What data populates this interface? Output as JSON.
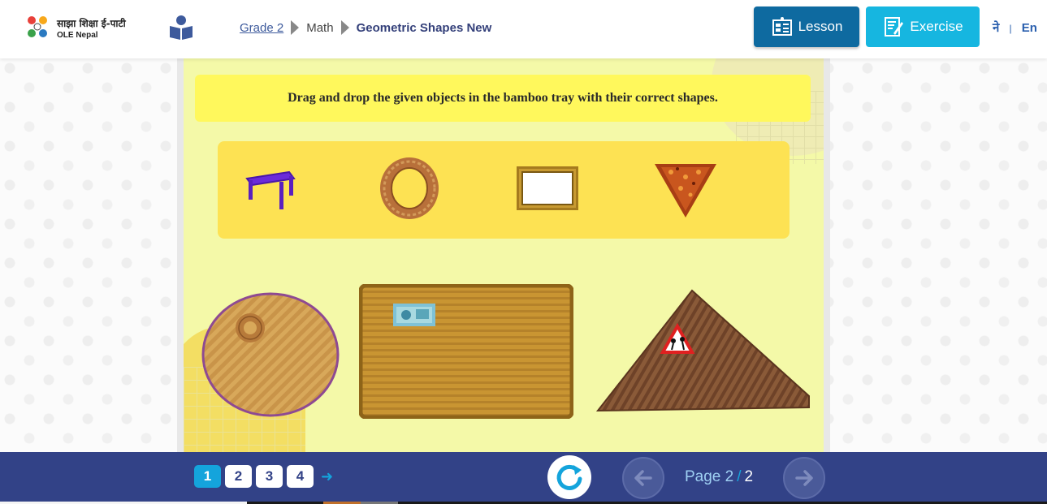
{
  "header": {
    "logo_title": "साझा शिक्षा ई-पाटी",
    "logo_subtitle": "OLE Nepal",
    "breadcrumb": {
      "grade": "Grade 2",
      "subject": "Math",
      "topic": "Geometric Shapes New"
    },
    "lesson_label": "Lesson",
    "exercise_label": "Exercise",
    "lang_ne": "ने",
    "lang_sep": "|",
    "lang_en": "En"
  },
  "activity": {
    "instruction": "Drag and drop the given objects in the bamboo tray with their correct shapes.",
    "objects": [
      "stool",
      "bread-ring",
      "picture-frame",
      "samosa"
    ],
    "trays": [
      "circle-tray",
      "rectangle-tray",
      "triangle-tray"
    ]
  },
  "footer": {
    "tabs": [
      "1",
      "2",
      "3",
      "4"
    ],
    "active_tab": "1",
    "page_label": "Page",
    "current_page": "2",
    "page_sep": "/",
    "total_pages": "2"
  },
  "colors": {
    "header_lesson": "#0e6aa0",
    "header_exercise": "#16b6e0",
    "footer_bg": "#324287",
    "panel_bg": "#f4f9a8",
    "instruction_bg": "#fff85c",
    "tray_bg": "#fde253"
  }
}
